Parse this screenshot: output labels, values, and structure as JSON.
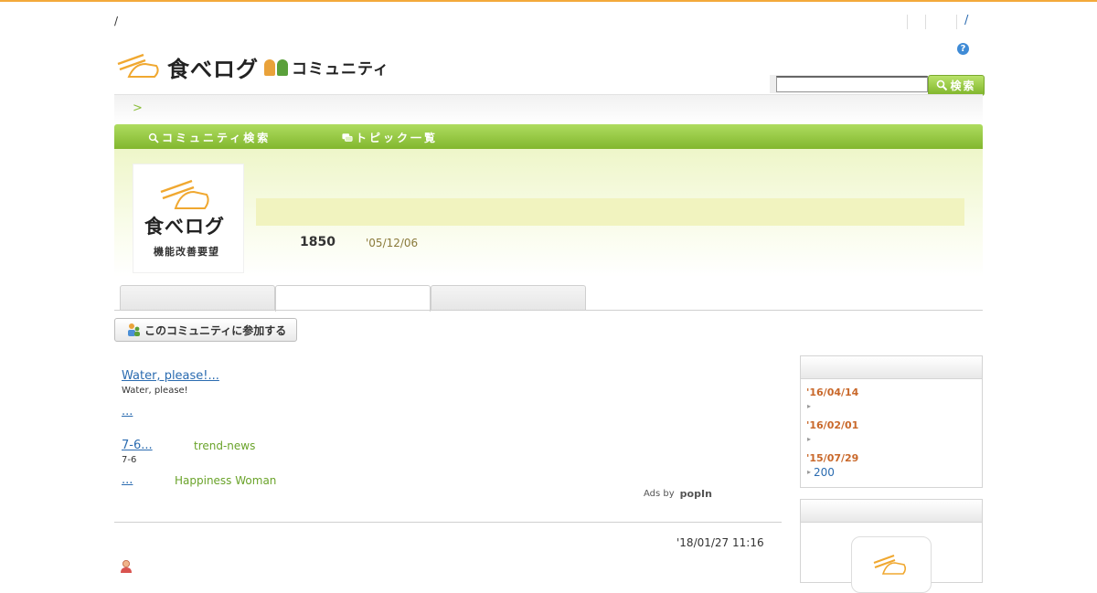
{
  "utility": {
    "left_slash": "/",
    "right_slash": "/",
    "help_label": "?"
  },
  "logo": {
    "brand": "食べログ",
    "community": "コミュニティ"
  },
  "search": {
    "button_label": "検索",
    "placeholder": ""
  },
  "breadcrumb": {
    "separator": ">"
  },
  "nav": {
    "items": [
      {
        "label": "コミュニティ検索"
      },
      {
        "label": "トピック一覧"
      }
    ]
  },
  "community": {
    "thumb_brand": "食べログ",
    "thumb_sub": "機能改善要望",
    "member_count": "1850",
    "created": "'05/12/06"
  },
  "join_button": {
    "label": "このコミュニティに参加する"
  },
  "ads": {
    "items": [
      {
        "title": "Water, please!...",
        "desc": "Water, please!",
        "source": ""
      },
      {
        "title": "...",
        "desc": "",
        "source": ""
      },
      {
        "title": "7-6...",
        "desc": "7-6",
        "source": "trend-news"
      },
      {
        "title": "...",
        "desc": "",
        "source": "Happiness Woman"
      }
    ],
    "ads_by": "Ads by",
    "provider": "popIn"
  },
  "post": {
    "date": "'18/01/27 11:16"
  },
  "sidebar": {
    "updates": [
      {
        "date": "'16/04/14"
      },
      {
        "date": "'16/02/01"
      },
      {
        "date": "'15/07/29",
        "link": "200"
      }
    ]
  },
  "colors": {
    "accent_green": "#8cbf3c",
    "top_border": "#f3a93a",
    "date_orange": "#c9682a",
    "link_blue": "#2a6bb0"
  }
}
